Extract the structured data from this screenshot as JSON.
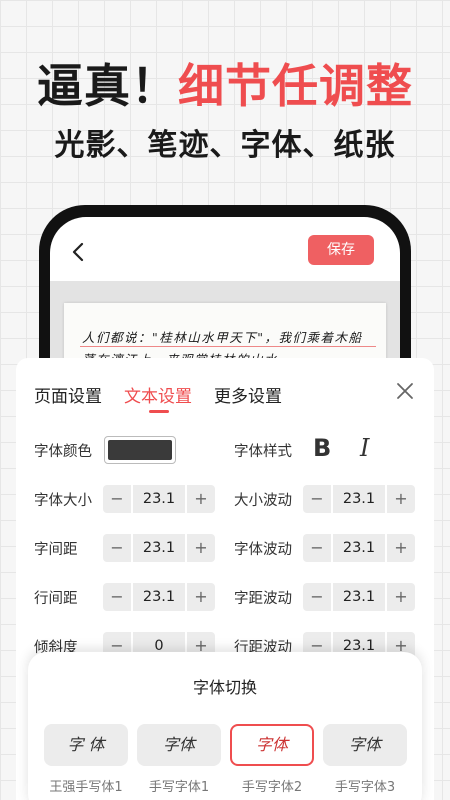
{
  "headline": {
    "part1": "逼真！",
    "part2": "细节任调整"
  },
  "subline": "光影、笔迹、字体、纸张",
  "phone": {
    "save_label": "保存",
    "handwriting_line1": "人们都说：\"桂林山水甲天下\"，我们乘着木船",
    "handwriting_line2": "荡在漓江上，来观赏桂林的山水。"
  },
  "sheet": {
    "tabs": [
      "页面设置",
      "文本设置",
      "更多设置"
    ],
    "active_tab": "文本设置",
    "font_color_label": "字体颜色",
    "font_color": "#3a3a3a",
    "font_style_label": "字体样式",
    "bold_glyph": "B",
    "italic_glyph": "I",
    "rows": [
      {
        "left_label": "字体大小",
        "left_value": "23.1",
        "right_label": "大小波动",
        "right_value": "23.1"
      },
      {
        "left_label": "字间距",
        "left_value": "23.1",
        "right_label": "字体波动",
        "right_value": "23.1"
      },
      {
        "left_label": "行间距",
        "left_value": "23.1",
        "right_label": "字距波动",
        "right_value": "23.1"
      },
      {
        "left_label": "倾斜度",
        "left_value": "0",
        "right_label": "行距波动",
        "right_value": "23.1"
      }
    ],
    "minus": "−",
    "plus": "+"
  },
  "font_panel": {
    "title": "字体切换",
    "fonts": [
      {
        "preview": "字 体",
        "name": "王强手写体1"
      },
      {
        "preview": "字体",
        "name": "手写字体1"
      },
      {
        "preview": "字体",
        "name": "手写字体2"
      },
      {
        "preview": "字体",
        "name": "手写字体3"
      }
    ],
    "selected_index": 2
  },
  "colors": {
    "accent": "#ef4d4f",
    "save_button": "#ef6062"
  }
}
